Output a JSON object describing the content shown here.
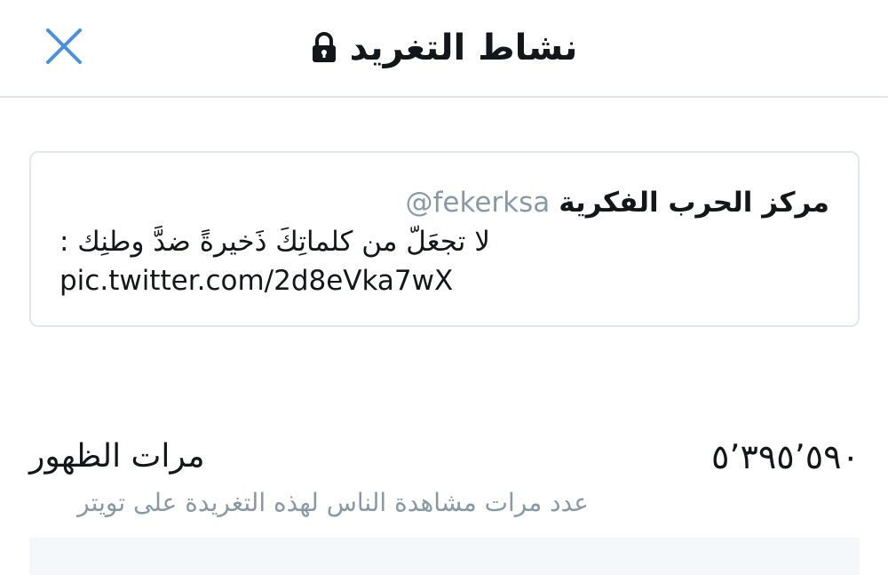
{
  "header": {
    "title": "نشاط التغريد",
    "close_icon": "close-icon",
    "lock_icon": "lock-icon",
    "accent_color": "#4a90e2"
  },
  "tweet": {
    "author_name": "مركز الحرب الفكرية",
    "handle": "@fekerksa",
    "text": "لا تجعَلّ من كلماتِكَ ذَخيرةً ضدَّ وطنِك :",
    "link": "pic.twitter.com/2d8eVka7wX"
  },
  "impressions": {
    "label": "مرات الظهور",
    "value": "٥٬٣٩٥٬٥٩٠",
    "description": "عدد مرات مشاهدة الناس لهذه التغريدة على تويتر"
  }
}
